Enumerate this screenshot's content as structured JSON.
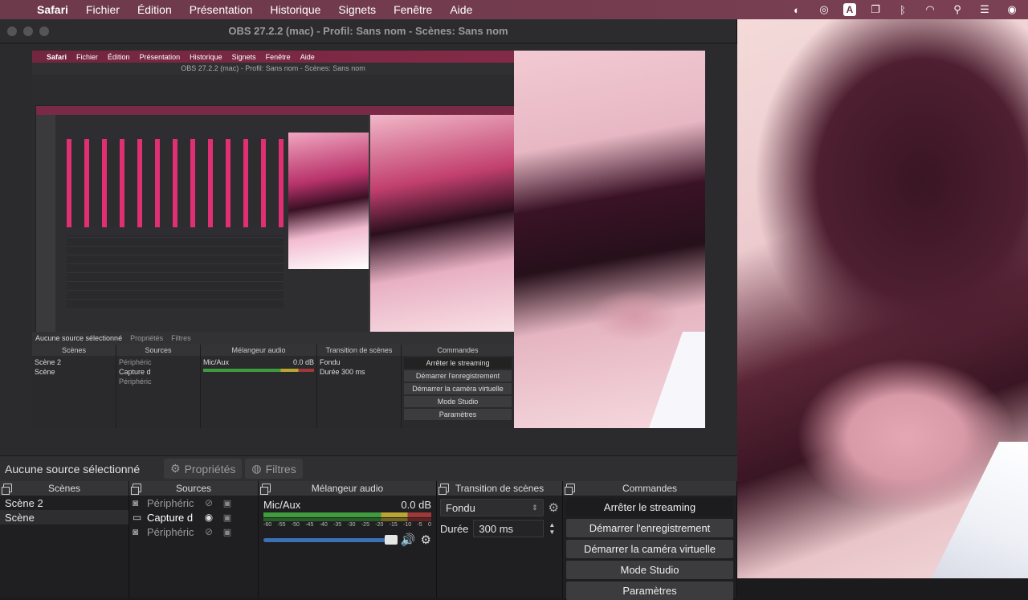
{
  "menubar": {
    "app": "Safari",
    "items": [
      "Fichier",
      "Édition",
      "Présentation",
      "Historique",
      "Signets",
      "Fenêtre",
      "Aide"
    ]
  },
  "window": {
    "title": "OBS 27.2.2 (mac) - Profil: Sans nom - Scènes: Sans nom"
  },
  "source_bar": {
    "no_source": "Aucune source sélectionné",
    "properties": "Propriétés",
    "filters": "Filtres"
  },
  "scenes": {
    "header": "Scènes",
    "items": [
      "Scène 2",
      "Scène"
    ]
  },
  "sources": {
    "header": "Sources",
    "items": [
      "Périphéric",
      "Capture d",
      "Périphéric"
    ]
  },
  "mixer": {
    "header": "Mélangeur audio",
    "channel": "Mic/Aux",
    "level": "0.0 dB",
    "ticks": [
      "-60",
      "-55",
      "-50",
      "-45",
      "-40",
      "-35",
      "-30",
      "-25",
      "-20",
      "-15",
      "-10",
      "-5",
      "0"
    ]
  },
  "transition": {
    "header": "Transition de scènes",
    "type": "Fondu",
    "duration_label": "Durée",
    "duration": "300 ms"
  },
  "commands": {
    "header": "Commandes",
    "stop_stream": "Arrêter le streaming",
    "start_record": "Démarrer l'enregistrement",
    "start_vcam": "Démarrer la caméra virtuelle",
    "studio": "Mode Studio",
    "settings": "Paramètres"
  },
  "colors": {
    "menubar": "#6d3a4b",
    "meter_green": "#3e9b3e",
    "meter_yellow": "#b9a531",
    "meter_red": "#a03838",
    "slider": "#3b6fb6"
  }
}
